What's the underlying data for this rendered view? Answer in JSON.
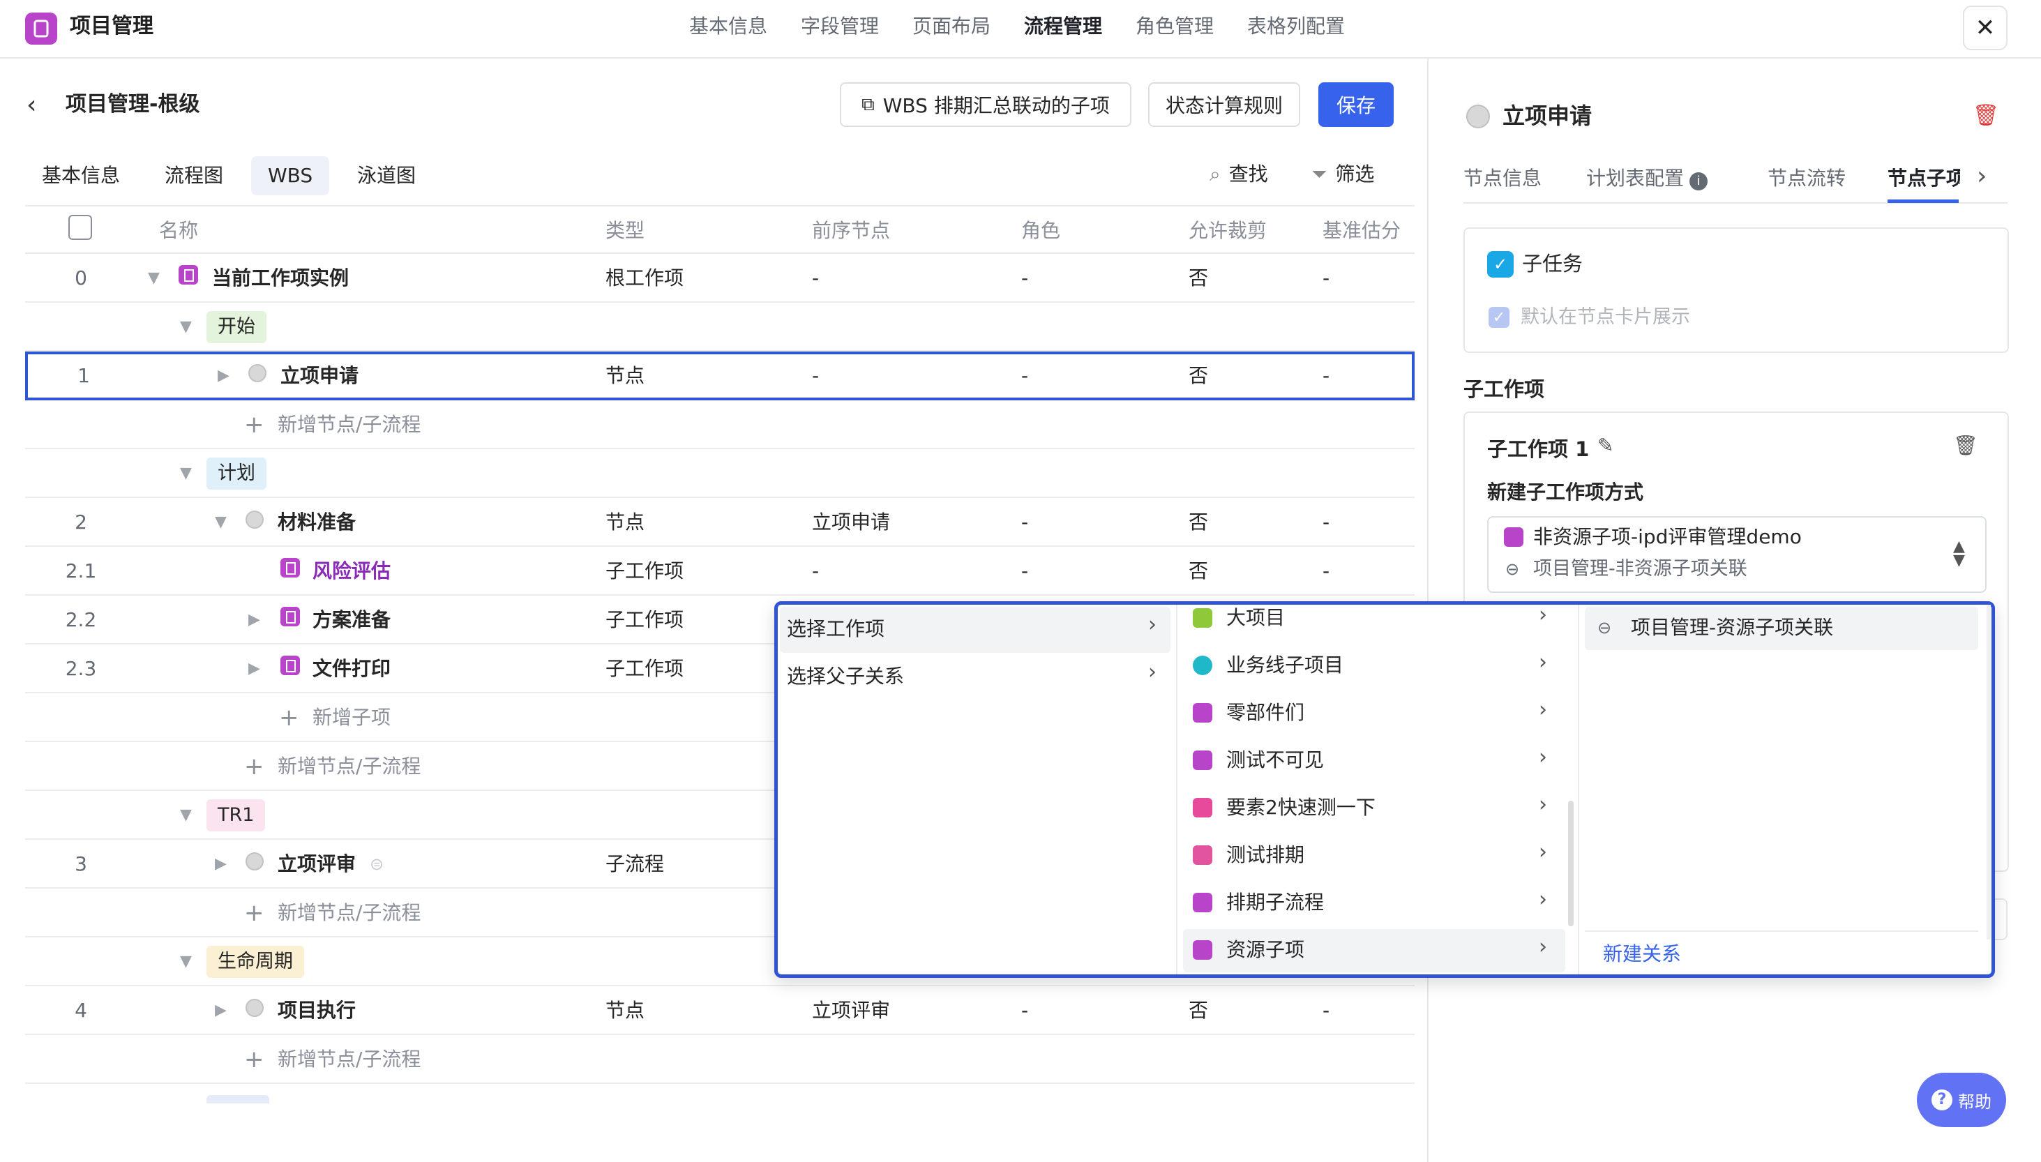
{
  "app": {
    "title": "项目管理"
  },
  "top_nav": [
    "基本信息",
    "字段管理",
    "页面布局",
    "流程管理",
    "角色管理",
    "表格列配置"
  ],
  "top_nav_active": "流程管理",
  "page": {
    "title": "项目管理-根级"
  },
  "buttons": {
    "wbs_link": "WBS 排期汇总联动的子项",
    "status_rule": "状态计算规则",
    "save": "保存"
  },
  "sub_tabs": [
    "基本信息",
    "流程图",
    "WBS",
    "泳道图"
  ],
  "sub_tab_active": "WBS",
  "tools": {
    "find": "查找",
    "filter": "筛选"
  },
  "table": {
    "columns": [
      "名称",
      "类型",
      "前序节点",
      "角色",
      "允许裁剪",
      "基准估分"
    ],
    "rows": [
      {
        "idx": "0",
        "name": "当前工作项实例",
        "type": "根工作项",
        "pre": "-",
        "role": "-",
        "cut": "否",
        "est": "-"
      },
      {
        "group": "开始"
      },
      {
        "idx": "1",
        "name": "立项申请",
        "type": "节点",
        "pre": "-",
        "role": "-",
        "cut": "否",
        "est": "-"
      },
      {
        "add": "新增节点/子流程"
      },
      {
        "group": "计划"
      },
      {
        "idx": "2",
        "name": "材料准备",
        "type": "节点",
        "pre": "立项申请",
        "role": "-",
        "cut": "否",
        "est": "-"
      },
      {
        "idx": "2.1",
        "name": "风险评估",
        "type": "子工作项",
        "pre": "-",
        "role": "-",
        "cut": "否",
        "est": "-"
      },
      {
        "idx": "2.2",
        "name": "方案准备",
        "type": "子工作项"
      },
      {
        "idx": "2.3",
        "name": "文件打印",
        "type": "子工作项"
      },
      {
        "add": "新增子项"
      },
      {
        "add": "新增节点/子流程"
      },
      {
        "group": "TR1"
      },
      {
        "idx": "3",
        "name": "立项评审",
        "type": "子流程"
      },
      {
        "add": "新增节点/子流程"
      },
      {
        "group": "生命周期"
      },
      {
        "idx": "4",
        "name": "项目执行",
        "type": "节点",
        "pre": "立项评审",
        "role": "-",
        "cut": "否",
        "est": "-"
      },
      {
        "add": "新增节点/子流程"
      }
    ]
  },
  "right_panel": {
    "title": "立项申请",
    "tabs": [
      "节点信息",
      "计划表配置",
      "节点流转",
      "节点子项"
    ],
    "subtask_label": "子任务",
    "show_in_card": "默认在节点卡片展示",
    "section_title": "子工作项",
    "item_title": "子工作项 1",
    "create_method_label": "新建子工作项方式",
    "select_line1": "非资源子项-ipd评审管理demo",
    "select_line2": "项目管理-非资源子项关联"
  },
  "popup": {
    "col1": [
      "选择工作项",
      "选择父子关系"
    ],
    "col2": [
      "大项目",
      "业务线子项目",
      "零部件们",
      "测试不可见",
      "要素2快速测一下",
      "测试排期",
      "排期子流程",
      "资源子项"
    ],
    "col3": [
      "项目管理-资源子项关联"
    ],
    "new_relation": "新建关系"
  },
  "help": "帮助",
  "colors": {
    "accent": "#3662ec",
    "purple": "#b845c9",
    "danger": "#e03a3a"
  }
}
